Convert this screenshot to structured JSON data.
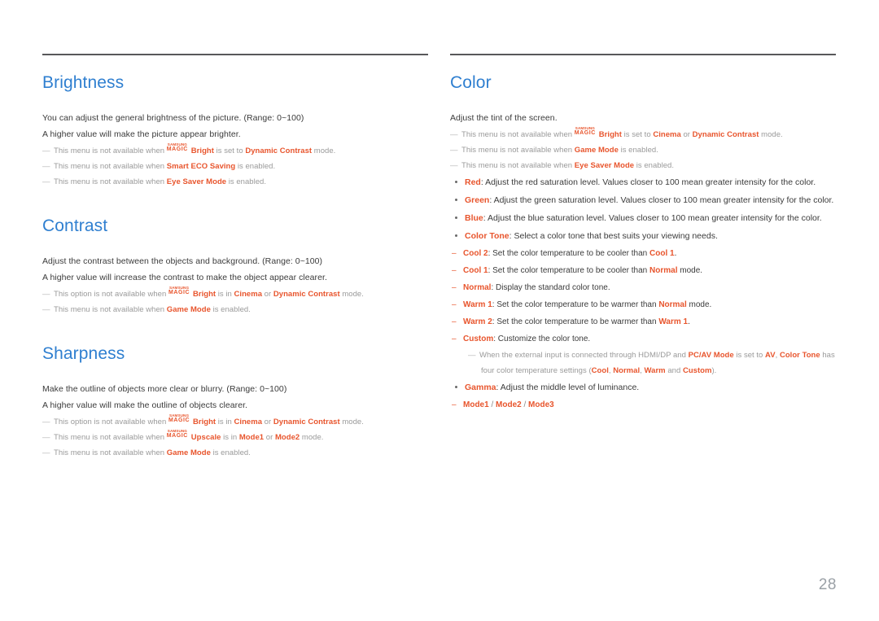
{
  "document": {
    "page_number": "28",
    "accent_heading_color": "#2f7fd0",
    "accent_highlight_color": "#e8552d",
    "rule_color": "#58585a"
  },
  "left_column": {
    "sections": [
      {
        "title": "Brightness",
        "paragraphs": [
          "You can adjust the general brightness of the picture. (Range: 0~100)",
          "A higher value will make the picture appear brighter."
        ],
        "notes": [
          {
            "dash": "—",
            "pre": "This menu is not available when ",
            "logo_top": "SAMSUNG",
            "logo_bottom": "MAGIC",
            "logo_suffix": "Bright",
            "mid": " is set to ",
            "hl1": "Dynamic Contrast",
            "post": " mode."
          },
          {
            "dash": "—",
            "pre": "This menu is not available when ",
            "hl1": "Smart ECO Saving",
            "post": " is enabled."
          },
          {
            "dash": "—",
            "pre": "This menu is not available when ",
            "hl1": "Eye Saver Mode",
            "post": " is enabled."
          }
        ]
      },
      {
        "title": "Contrast",
        "paragraphs": [
          "Adjust the contrast between the objects and background. (Range: 0~100)",
          "A higher value will increase the contrast to make the object appear clearer."
        ],
        "notes": [
          {
            "dash": "—",
            "pre": "This option is not available when ",
            "logo_top": "SAMSUNG",
            "logo_bottom": "MAGIC",
            "logo_suffix": "Bright",
            "mid": " is in ",
            "hl1": "Cinema",
            "mid2": " or ",
            "hl2": "Dynamic Contrast",
            "post": " mode."
          },
          {
            "dash": "—",
            "pre": "This menu is not available when ",
            "hl1": "Game Mode",
            "post": " is enabled."
          }
        ]
      },
      {
        "title": "Sharpness",
        "paragraphs": [
          "Make the outline of objects more clear or blurry. (Range: 0~100)",
          "A higher value will make the outline of objects clearer."
        ],
        "notes": [
          {
            "dash": "—",
            "pre": "This option is not available when ",
            "logo_top": "SAMSUNG",
            "logo_bottom": "MAGIC",
            "logo_suffix": "Bright",
            "mid": " is in ",
            "hl1": "Cinema",
            "mid2": " or ",
            "hl2": "Dynamic Contrast",
            "post": " mode."
          },
          {
            "dash": "—",
            "pre": "This menu is not available when ",
            "logo_top": "SAMSUNG",
            "logo_bottom": "MAGIC",
            "logo_suffix": "Upscale",
            "mid": " is in ",
            "hl1": "Mode1",
            "mid2": " or ",
            "hl2": "Mode2",
            "post": " mode."
          },
          {
            "dash": "—",
            "pre": "This menu is not available when ",
            "hl1": "Game Mode",
            "post": " is enabled."
          }
        ]
      }
    ]
  },
  "right_column": {
    "section": {
      "title": "Color",
      "paragraphs": [
        "Adjust the tint of the screen."
      ],
      "notes": [
        {
          "dash": "—",
          "pre": "This menu is not available when ",
          "logo_top": "SAMSUNG",
          "logo_bottom": "MAGIC",
          "logo_suffix": "Bright",
          "mid": " is set to ",
          "hl1": "Cinema",
          "mid2": " or ",
          "hl2": "Dynamic Contrast",
          "post": " mode."
        },
        {
          "dash": "—",
          "pre": "This menu is not available when ",
          "hl1": "Game Mode",
          "post": " is enabled."
        },
        {
          "dash": "—",
          "pre": "This menu is not available when ",
          "hl1": "Eye Saver Mode",
          "post": " is enabled."
        }
      ],
      "bullets": [
        {
          "term": "Red",
          "text": ": Adjust the red saturation level. Values closer to 100 mean greater intensity for the color."
        },
        {
          "term": "Green",
          "text": ": Adjust the green saturation level. Values closer to 100 mean greater intensity for the color."
        },
        {
          "term": "Blue",
          "text": ": Adjust the blue saturation level. Values closer to 100 mean greater intensity for the color."
        },
        {
          "term": "Color Tone",
          "text": ": Select a color tone that best suits your viewing needs."
        }
      ],
      "color_tone_options": [
        {
          "dash": "–",
          "term": "Cool 2",
          "pre": ": Set the color temperature to be cooler than ",
          "ref": "Cool 1",
          "post": "."
        },
        {
          "dash": "–",
          "term": "Cool 1",
          "pre": ": Set the color temperature to be cooler than ",
          "ref": "Normal",
          "post": " mode."
        },
        {
          "dash": "–",
          "term": "Normal",
          "pre": ": Display the standard color tone.",
          "ref": "",
          "post": ""
        },
        {
          "dash": "–",
          "term": "Warm 1",
          "pre": ": Set the color temperature to be warmer than ",
          "ref": "Normal",
          "post": " mode."
        },
        {
          "dash": "–",
          "term": "Warm 2",
          "pre": ": Set the color temperature to be warmer than ",
          "ref": "Warm 1",
          "post": "."
        },
        {
          "dash": "–",
          "term": "Custom",
          "pre": ": Customize the color tone.",
          "ref": "",
          "post": ""
        }
      ],
      "external_input_note": {
        "dash": "—",
        "line1_pre": "When the external input is connected through HDMI/DP and ",
        "line1_hl1": "PC/AV Mode",
        "line1_mid": " is set to ",
        "line1_hl2": "AV",
        "line1_mid2": ", ",
        "line1_hl3": "Color Tone",
        "line1_post": " has",
        "line2_pre": "four color temperature settings (",
        "line2_hl1": "Cool",
        "line2_sep1": ", ",
        "line2_hl2": "Normal",
        "line2_sep2": ", ",
        "line2_hl3": "Warm",
        "line2_sep3": " and ",
        "line2_hl4": "Custom",
        "line2_post": ")."
      },
      "gamma_bullet": {
        "term": "Gamma",
        "text": ": Adjust the middle level of luminance."
      },
      "gamma_modes": {
        "dash": "–",
        "mode1": "Mode1",
        "sep1": " / ",
        "mode2": "Mode2",
        "sep2": " / ",
        "mode3": "Mode3"
      }
    }
  }
}
